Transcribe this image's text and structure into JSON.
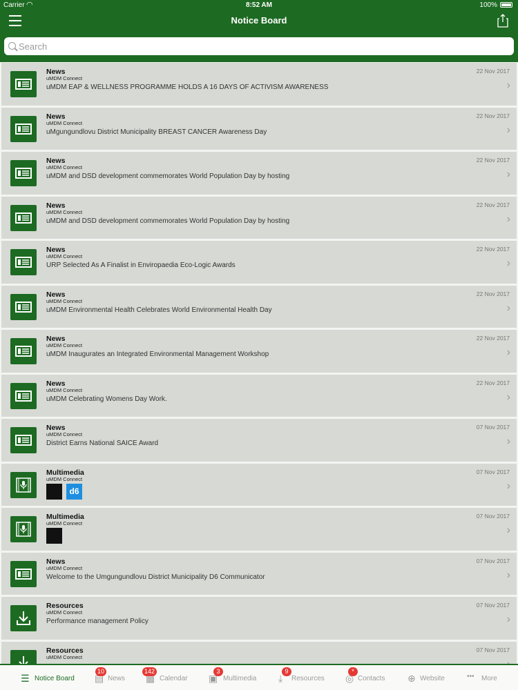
{
  "status_bar": {
    "carrier": "Carrier",
    "time": "8:52 AM",
    "battery": "100%"
  },
  "header": {
    "title": "Notice Board"
  },
  "search": {
    "placeholder": "Search"
  },
  "items": [
    {
      "category": "News",
      "source": "uMDM Connect",
      "title": "uMDM EAP & WELLNESS PROGRAMME HOLDS A 16 DAYS OF ACTIVISM AWARENESS",
      "date": "22 Nov 2017",
      "icon": "news-icon"
    },
    {
      "category": "News",
      "source": "uMDM Connect",
      "title": "uMgungundlovu District Municipality BREAST CANCER Awareness Day",
      "date": "22 Nov 2017",
      "icon": "news-icon"
    },
    {
      "category": "News",
      "source": "uMDM Connect",
      "title": "uMDM and DSD development commemorates World Population Day by hosting",
      "date": "22 Nov 2017",
      "icon": "news-icon"
    },
    {
      "category": "News",
      "source": "uMDM Connect",
      "title": "uMDM and DSD development commemorates World Population Day by hosting",
      "date": "22 Nov 2017",
      "icon": "news-icon"
    },
    {
      "category": "News",
      "source": "uMDM Connect",
      "title": "URP Selected As A Finalist in Enviropaedia Eco-Logic Awards",
      "date": "22 Nov 2017",
      "icon": "news-icon"
    },
    {
      "category": "News",
      "source": "uMDM Connect",
      "title": "uMDM Environmental Health Celebrates  World Environmental Health Day",
      "date": "22 Nov 2017",
      "icon": "news-icon"
    },
    {
      "category": "News",
      "source": "uMDM Connect",
      "title": "uMDM Inaugurates an Integrated Environmental Management Workshop",
      "date": "22 Nov 2017",
      "icon": "news-icon"
    },
    {
      "category": "News",
      "source": "uMDM Connect",
      "title": "uMDM Celebrating Womens Day Work.",
      "date": "22 Nov 2017",
      "icon": "news-icon"
    },
    {
      "category": "News",
      "source": "uMDM Connect",
      "title": "District Earns National SAICE Award",
      "date": "07 Nov 2017",
      "icon": "news-icon"
    },
    {
      "category": "Multimedia",
      "source": "uMDM Connect",
      "title": "",
      "date": "07 Nov 2017",
      "icon": "multimedia-icon",
      "thumbs": [
        "photo",
        "d6"
      ]
    },
    {
      "category": "Multimedia",
      "source": "uMDM Connect",
      "title": "",
      "date": "07 Nov 2017",
      "icon": "multimedia-icon",
      "thumbs": [
        "photo"
      ]
    },
    {
      "category": "News",
      "source": "uMDM Connect",
      "title": "Welcome to the Umgungundlovu District Municipality D6 Communicator",
      "date": "07 Nov 2017",
      "icon": "news-icon"
    },
    {
      "category": "Resources",
      "source": "uMDM Connect",
      "title": "Performance management Policy",
      "date": "07 Nov 2017",
      "icon": "download-icon"
    },
    {
      "category": "Resources",
      "source": "uMDM Connect",
      "title": "",
      "date": "07 Nov 2017",
      "icon": "download-icon"
    }
  ],
  "tabs": [
    {
      "label": "Notice Board",
      "badge": "",
      "icon": "list-icon",
      "active": true
    },
    {
      "label": "News",
      "badge": "10",
      "icon": "news-icon",
      "active": false
    },
    {
      "label": "Calendar",
      "badge": "142",
      "icon": "calendar-icon",
      "active": false
    },
    {
      "label": "Multimedia",
      "badge": "3",
      "icon": "multimedia-icon",
      "active": false
    },
    {
      "label": "Resources",
      "badge": "9",
      "icon": "download-icon",
      "active": false
    },
    {
      "label": "Contacts",
      "badge": "*",
      "icon": "contact-icon",
      "active": false
    },
    {
      "label": "Website",
      "badge": "",
      "icon": "globe-icon",
      "active": false
    },
    {
      "label": "More",
      "badge": "",
      "icon": "more-icon",
      "active": false
    }
  ],
  "colors": {
    "brand_green": "#1d6a22",
    "badge_red": "#e53935",
    "row_bg": "#d6d9d4"
  }
}
